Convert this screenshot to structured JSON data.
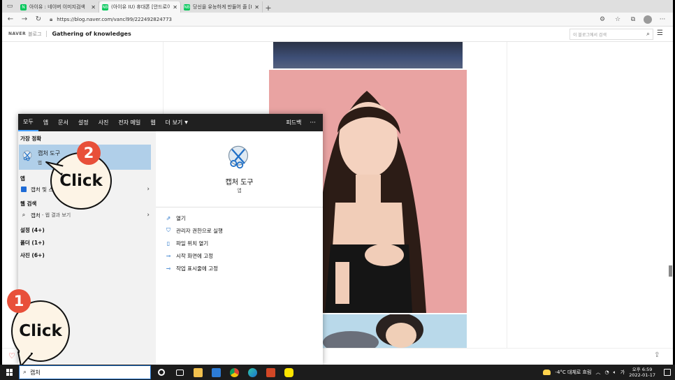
{
  "browser": {
    "tabs": [
      {
        "label": "아이유 : 네이버 이미지검색",
        "fav": "N",
        "active": false
      },
      {
        "label": "(아이유 IU) 휴대폰 [안드로이드",
        "fav": "NB",
        "active": true
      },
      {
        "label": "당신을 유능하게 만들어 줄 [Icl...",
        "fav": "NB",
        "active": false
      }
    ],
    "url": "https://blog.naver.com/vancl99/222492824773"
  },
  "blog": {
    "logo": "NAVER",
    "blog_word": "블로그",
    "title": "Gathering of knowledges",
    "search_placeholder": "이 블로그에서 검색"
  },
  "search_panel": {
    "tabs": [
      "모두",
      "앱",
      "문서",
      "설정",
      "사진",
      "전자 메일",
      "웹",
      "더 보기"
    ],
    "feedback": "피드백",
    "more": "···",
    "best_match_head": "가장 정확",
    "best_match": {
      "name": "캡처 도구",
      "type": "앱"
    },
    "apps_head": "앱",
    "apps_item": "캡처 및 스케치",
    "web_head": "웹 검색",
    "web_item": {
      "query": "캡처",
      "suffix": "- 웹 결과 보기"
    },
    "settings_head": "설정 (4+)",
    "folders_head": "폴더 (1+)",
    "photos_head": "사진 (6+)",
    "detail": {
      "name": "캡처 도구",
      "type": "앱",
      "actions": [
        "열기",
        "관리자 권한으로 실행",
        "파일 위치 열기",
        "시작 화면에 고정",
        "작업 표시줄에 고정"
      ]
    }
  },
  "callouts": [
    {
      "number": "1",
      "text": "Click"
    },
    {
      "number": "2",
      "text": "Click"
    }
  ],
  "taskbar": {
    "search_text": "캡처",
    "weather": "-4°C 대체로 흐림",
    "ime": "가",
    "time": "오후 6:59",
    "date": "2022-01-17",
    "pinned_apps": [
      "cortana",
      "task-view",
      "file-explorer",
      "store",
      "chrome",
      "edge",
      "powerpoint",
      "kakaotalk"
    ]
  }
}
